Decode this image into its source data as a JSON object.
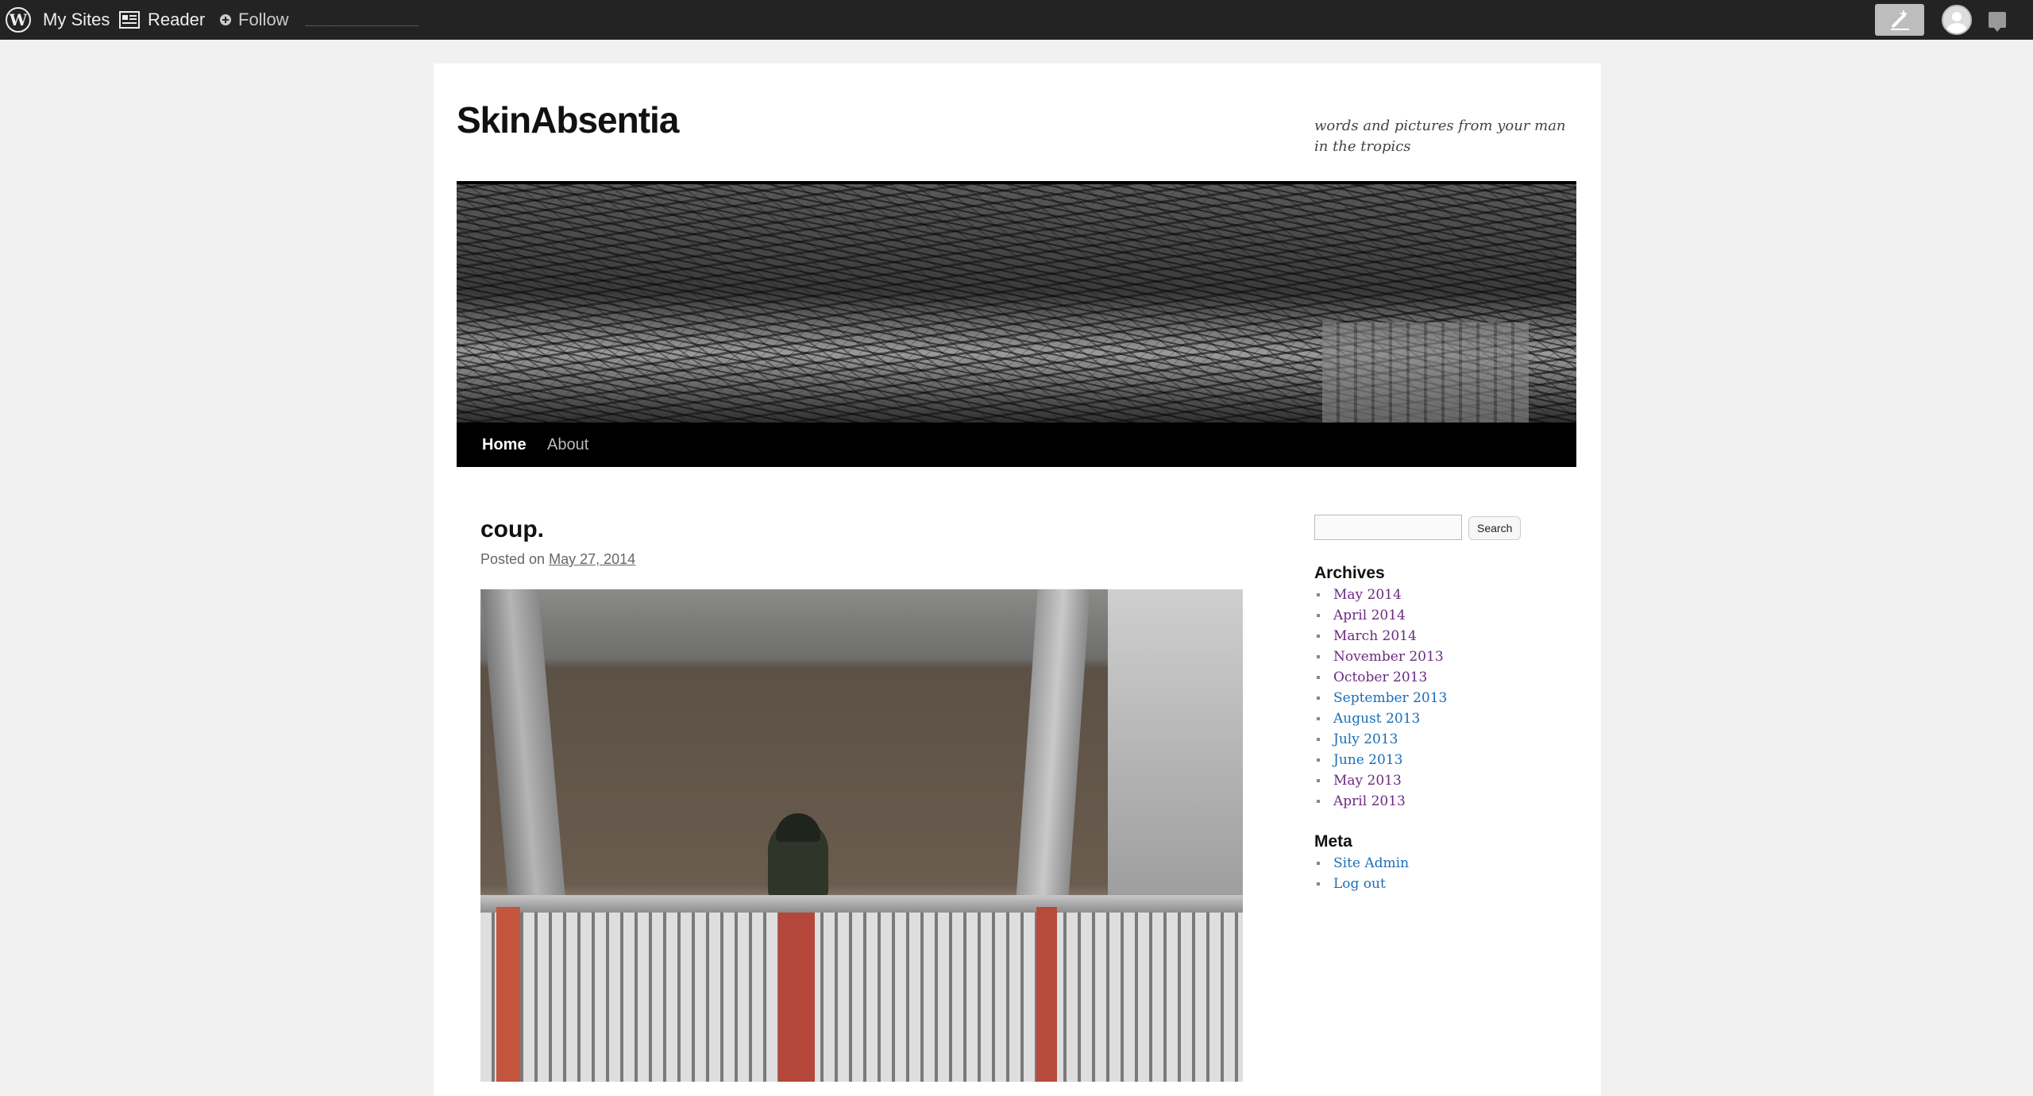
{
  "adminbar": {
    "my_sites": "My Sites",
    "reader": "Reader",
    "follow": "Follow"
  },
  "site": {
    "title": "SkinAbsentia",
    "description": "words and pictures from your man in the tropics"
  },
  "nav": {
    "items": [
      {
        "label": "Home"
      },
      {
        "label": "About"
      }
    ]
  },
  "post": {
    "title": "coup.",
    "meta_prefix": "Posted on",
    "date": "May 27, 2014"
  },
  "sidebar": {
    "search_button": "Search",
    "archives_title": "Archives",
    "archives": [
      {
        "label": "May 2014"
      },
      {
        "label": "April 2014"
      },
      {
        "label": "March 2014"
      },
      {
        "label": "November 2013"
      },
      {
        "label": "October 2013"
      },
      {
        "label": "September 2013"
      },
      {
        "label": "August 2013"
      },
      {
        "label": "July 2013"
      },
      {
        "label": "June 2013"
      },
      {
        "label": "May 2013"
      },
      {
        "label": "April 2013"
      }
    ],
    "meta_title": "Meta",
    "meta": [
      {
        "label": "Site Admin"
      },
      {
        "label": "Log out"
      }
    ]
  },
  "colors": {
    "adminbar_bg": "#232323",
    "nav_bg": "#000000",
    "visited_link": "#6b2a82",
    "link": "#1b6db8"
  }
}
